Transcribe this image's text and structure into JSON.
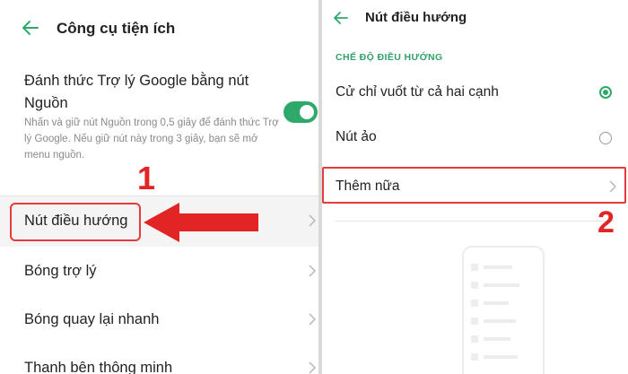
{
  "left_panel": {
    "title": "Công cụ tiện ích",
    "wake_assistant": {
      "title": "Đánh thức Trợ lý Google bằng nút Nguồn",
      "description": "Nhấn và giữ nút Nguồn trong 0,5 giây để đánh thức Trợ lý Google. Nếu giữ nút này trong 3 giây, bạn sẽ mở menu nguồn.",
      "toggle_on": true
    },
    "items": [
      {
        "label": "Nút điều hướng"
      },
      {
        "label": "Bóng trợ lý"
      },
      {
        "label": "Bóng quay lại nhanh"
      },
      {
        "label": "Thanh bên thông minh"
      }
    ],
    "step_number": "1"
  },
  "right_panel": {
    "title": "Nút điều hướng",
    "section_header": "CHẾ ĐỘ ĐIỀU HƯỚNG",
    "options": [
      {
        "label": "Cử chỉ vuốt từ cả hai cạnh",
        "selected": true
      },
      {
        "label": "Nút ảo",
        "selected": false
      }
    ],
    "more": {
      "label": "Thêm nữa"
    },
    "step_number": "2"
  },
  "colors": {
    "accent": "#2fa96a",
    "annotation": "#e32424",
    "text": "#222222",
    "secondary": "#8a8a8a"
  }
}
